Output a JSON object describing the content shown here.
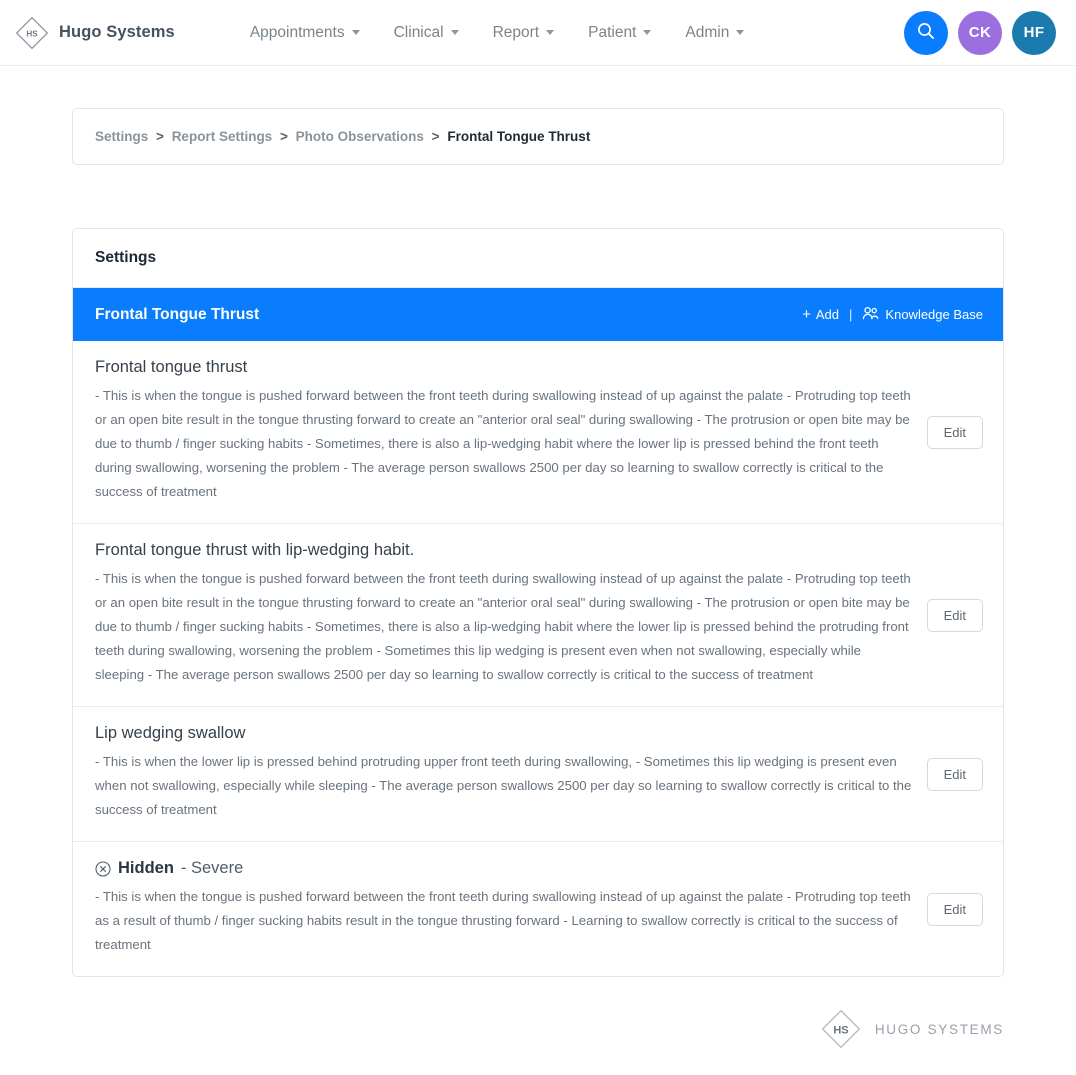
{
  "brand": {
    "name": "Hugo Systems",
    "logo_initials": "HS",
    "logo_icon": "diamond-hs-logo"
  },
  "nav": {
    "items": [
      {
        "label": "Appointments",
        "icon": "chevron-down-icon"
      },
      {
        "label": "Clinical",
        "icon": "chevron-down-icon"
      },
      {
        "label": "Report",
        "icon": "chevron-down-icon"
      },
      {
        "label": "Patient",
        "icon": "chevron-down-icon"
      },
      {
        "label": "Admin",
        "icon": "chevron-down-icon"
      }
    ],
    "search": {
      "icon": "search-icon",
      "color": "#0a7cfe"
    },
    "avatars": [
      {
        "initials": "CK",
        "color": "#9b6fe0"
      },
      {
        "initials": "HF",
        "color": "#1b7bae"
      }
    ]
  },
  "breadcrumb": {
    "separator": ">",
    "items": [
      {
        "label": "Settings",
        "current": false
      },
      {
        "label": "Report Settings",
        "current": false
      },
      {
        "label": "Photo Observations",
        "current": false
      },
      {
        "label": "Frontal Tongue Thrust",
        "current": true
      }
    ]
  },
  "settings": {
    "panel_title": "Settings",
    "header": {
      "title": "Frontal Tongue Thrust",
      "add_label": "Add",
      "add_icon": "plus-icon",
      "divider": "|",
      "knowledge_base_label": "Knowledge Base",
      "knowledge_base_icon": "users-icon",
      "background_color": "#0a7cfe"
    },
    "edit_label": "Edit",
    "observations": [
      {
        "title": "Frontal tongue thrust",
        "hidden": false,
        "body": "- This is when the tongue is pushed forward between the front teeth during swallowing instead of up against the palate - Protruding top teeth or an open bite result in the tongue thrusting forward to create an \"anterior oral seal\" during swallowing - The protrusion or open bite may be due to thumb / finger sucking habits - Sometimes, there is also a lip-wedging habit where the lower lip is pressed behind the front teeth during swallowing, worsening the problem - The average person swallows 2500 per day so learning to swallow correctly is critical to the success of treatment"
      },
      {
        "title": "Frontal tongue thrust with lip-wedging habit.",
        "hidden": false,
        "body": "- This is when the tongue is pushed forward between the front teeth during swallowing instead of up against the palate - Protruding top teeth or an open bite result in the tongue thrusting forward to create an \"anterior oral seal\" during swallowing - The protrusion or open bite may be due to thumb / finger sucking habits - Sometimes, there is also a lip-wedging habit where the lower lip is pressed behind the protruding front teeth during swallowing, worsening the problem - Sometimes this lip wedging is present even when not swallowing, especially while sleeping - The average person swallows 2500 per day so learning to swallow correctly is critical to the success of treatment"
      },
      {
        "title": "Lip wedging swallow",
        "hidden": false,
        "body": "- This is when the lower lip is pressed behind protruding upper front teeth during swallowing, - Sometimes this lip wedging is present even when not swallowing, especially while sleeping - The average person swallows 2500 per day so learning to swallow correctly is critical to the success of treatment"
      },
      {
        "title": "Hidden",
        "title_suffix": " - Severe",
        "hidden": true,
        "hidden_icon": "circle-x-icon",
        "body": "- This is when the tongue is pushed forward between the front teeth during swallowing instead of up against the palate - Protruding top teeth as a result of thumb / finger sucking habits result in the tongue thrusting forward - Learning to swallow correctly is critical to the success of treatment"
      }
    ]
  },
  "footer": {
    "logo_initials": "HS",
    "logo_icon": "diamond-hs-logo",
    "name": "HUGO SYSTEMS"
  }
}
